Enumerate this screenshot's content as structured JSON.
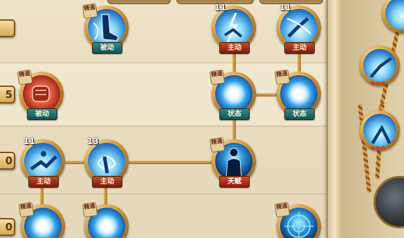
{
  "left_levels": [
    "",
    "5",
    "0",
    "0"
  ],
  "nodes": [
    {
      "id": "n-r0c1",
      "tag": "被动",
      "tag_type": "passive",
      "seal": "精通",
      "level": "",
      "style": "sky",
      "icon": "leg-icon"
    },
    {
      "id": "n-r0c3",
      "tag": "主动",
      "tag_type": "active",
      "seal": "",
      "level": "11",
      "style": "sky",
      "icon": "lightning-figure-icon"
    },
    {
      "id": "n-r0c4",
      "tag": "主动",
      "tag_type": "active",
      "seal": "",
      "level": "11",
      "style": "sky",
      "icon": "leaping-figure-icon"
    },
    {
      "id": "n-r1c0",
      "tag": "被动",
      "tag_type": "passive",
      "seal": "精通",
      "level": "",
      "style": "red",
      "icon": "fist-icon"
    },
    {
      "id": "n-r1c3",
      "tag": "状态",
      "tag_type": "state",
      "seal": "精通",
      "level": "",
      "style": "blue",
      "icon": "light-burst-icon"
    },
    {
      "id": "n-r1c4",
      "tag": "状态",
      "tag_type": "state",
      "seal": "精通",
      "level": "",
      "style": "blue",
      "icon": "light-burst-icon"
    },
    {
      "id": "n-r2c0",
      "tag": "主动",
      "tag_type": "active",
      "seal": "",
      "level": "11",
      "style": "sky",
      "icon": "kick-figure-icon"
    },
    {
      "id": "n-r2c1",
      "tag": "主动",
      "tag_type": "active",
      "seal": "",
      "level": "13",
      "style": "sky",
      "icon": "spin-figure-icon"
    },
    {
      "id": "n-r2c3",
      "tag": "天赋",
      "tag_type": "talent",
      "seal": "精通",
      "level": "",
      "style": "dark",
      "icon": "standing-figure-icon"
    },
    {
      "id": "n-r3c0",
      "tag": "",
      "tag_type": "",
      "seal": "精通",
      "level": "",
      "style": "blue",
      "icon": "light-burst-icon"
    },
    {
      "id": "n-r3c1",
      "tag": "",
      "tag_type": "",
      "seal": "精通",
      "level": "",
      "style": "blue",
      "icon": "light-burst-icon"
    },
    {
      "id": "n-r3c4",
      "tag": "",
      "tag_type": "",
      "seal": "精通",
      "level": "",
      "style": "dark",
      "icon": "target-sigil-icon"
    }
  ],
  "side_nodes": [
    {
      "id": "side-1",
      "diamonds": ""
    },
    {
      "id": "side-2",
      "diamonds": "◆◆◆"
    },
    {
      "id": "side-3",
      "diamonds": "◆◆◆"
    }
  ],
  "colors": {
    "gold": "#c98a2c",
    "parchment": "#efe4c9",
    "active_red": "#c24a24",
    "passive_teal": "#2e8c8a"
  }
}
